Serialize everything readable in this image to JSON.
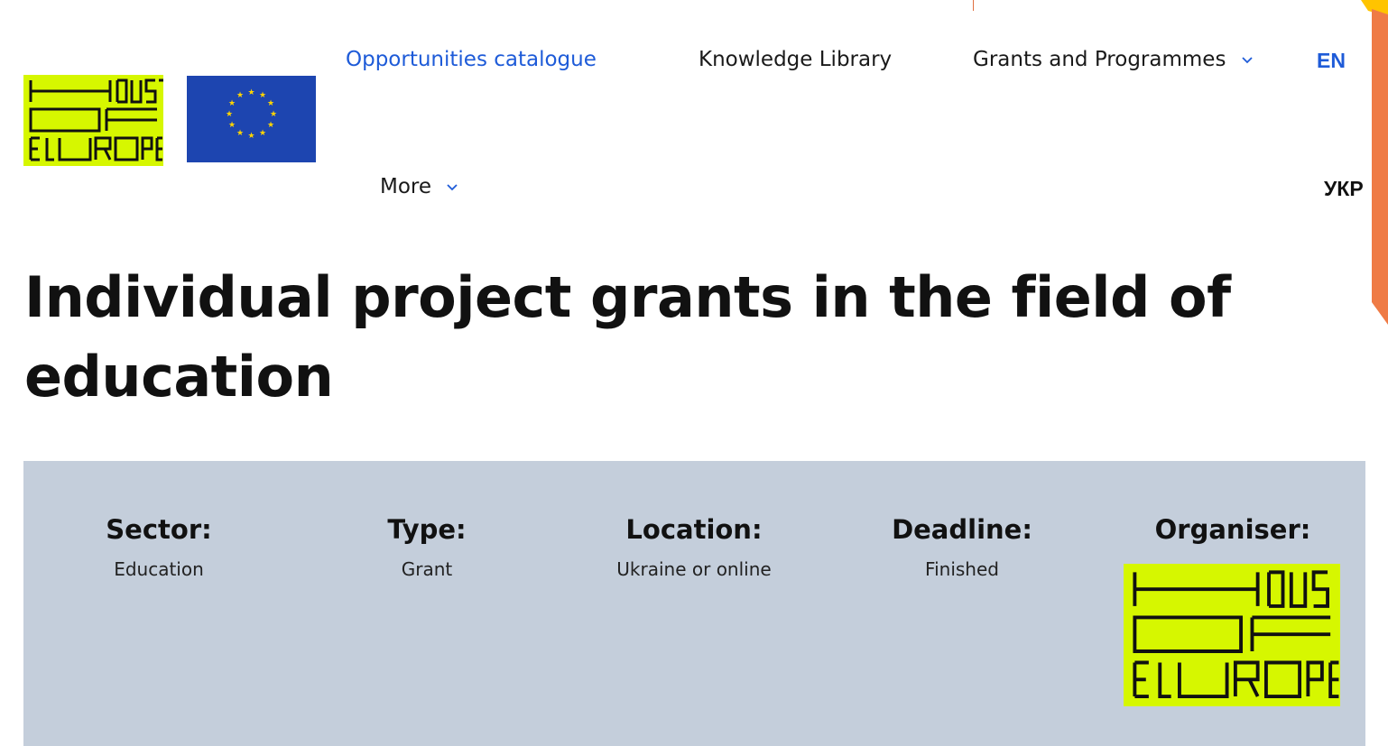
{
  "header": {
    "logo_alt": "House of Europe",
    "flag_alt": "European Union flag",
    "nav": {
      "opportunities": "Opportunities catalogue",
      "knowledge": "Knowledge Library",
      "grants": "Grants and Programmes",
      "more": "More"
    },
    "languages": {
      "en": "EN",
      "ukr": "УКР"
    }
  },
  "page": {
    "title": "Individual project grants in the field of education"
  },
  "details": {
    "sector": {
      "label": "Sector:",
      "value": "Education"
    },
    "type": {
      "label": "Type:",
      "value": "Grant"
    },
    "location": {
      "label": "Location:",
      "value": "Ukraine or online"
    },
    "deadline": {
      "label": "Deadline:",
      "value": "Finished"
    },
    "organiser": {
      "label": "Organiser:",
      "logo_alt": "House of Europe"
    }
  },
  "colors": {
    "brand_lime": "#d6f700",
    "link_blue": "#1e5bd8",
    "panel_bg": "#c4cedb",
    "eu_blue": "#1d45b0",
    "eu_star": "#ffd500",
    "accent_orange": "#ef7b45",
    "accent_yellow": "#ffc400"
  },
  "icons": {
    "chevron": "chevron-down-icon",
    "logo": "house-of-europe-logo",
    "flag": "eu-flag-icon"
  }
}
